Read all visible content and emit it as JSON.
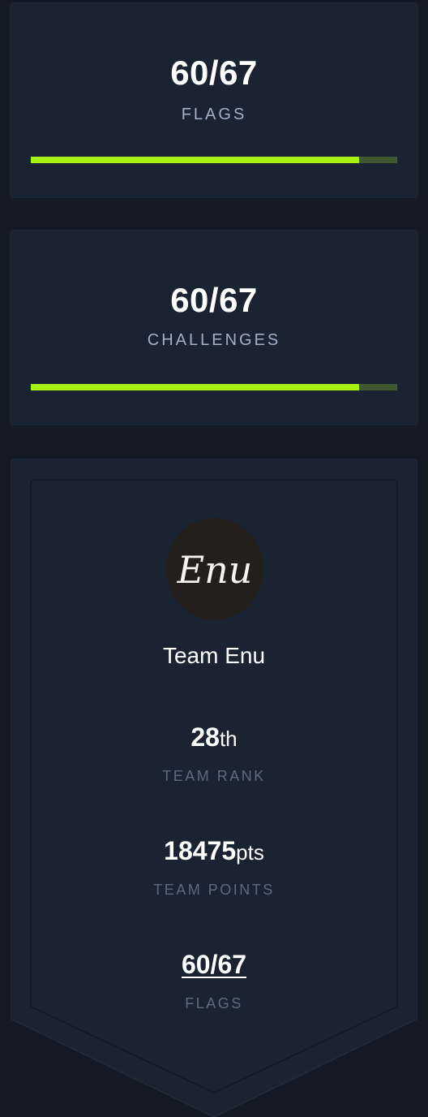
{
  "flags_card": {
    "value": "60/67",
    "label": "FLAGS",
    "progress": 0.896
  },
  "challenges_card": {
    "value": "60/67",
    "label": "CHALLENGES",
    "progress": 0.896
  },
  "team_badge": {
    "avatar_text": "Enu",
    "team_name": "Team Enu",
    "rank_value": "28",
    "rank_suffix": "th",
    "rank_label": "TEAM RANK",
    "points_value": "18475",
    "points_suffix": "pts",
    "points_label": "TEAM POINTS",
    "flags_value": "60/67",
    "flags_label": "FLAGS"
  },
  "colors": {
    "background": "#131a26",
    "card": "#1a2332",
    "progress_fill": "#a6f111",
    "progress_track": "#3f5a30",
    "label": "#a4afc8",
    "muted_label": "#5d6a80"
  }
}
